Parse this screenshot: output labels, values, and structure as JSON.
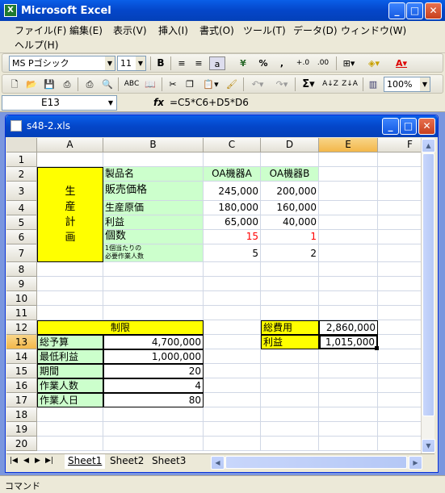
{
  "app": {
    "title": "Microsoft Excel",
    "icon_name": "excel-icon",
    "workbook_title": "s48-2.xls"
  },
  "menu": {
    "items": [
      "ファイル(F)",
      "編集(E)",
      "表示(V)",
      "挿入(I)",
      "書式(O)",
      "ツール(T)",
      "データ(D)",
      "ウィンドウ(W)"
    ],
    "help": "ヘルプ(H)"
  },
  "format_toolbar": {
    "font": "MS Pゴシック",
    "size": "11",
    "bold": "B",
    "percent": "%",
    "comma": ",",
    "inc_decimal": "+.0",
    "dec_decimal": ".00"
  },
  "standard_toolbar": {
    "zoom": "100%",
    "sigma": "Σ"
  },
  "formula_bar": {
    "name_box": "E13",
    "fx": "fx",
    "formula": "=C5*C6+D5*D6"
  },
  "columns": [
    "A",
    "B",
    "C",
    "D",
    "E",
    "F"
  ],
  "rows": [
    "1",
    "2",
    "3",
    "4",
    "5",
    "6",
    "7",
    "8",
    "9",
    "10",
    "11",
    "12",
    "13",
    "14",
    "15",
    "16",
    "17",
    "18",
    "19",
    "20"
  ],
  "sheet": {
    "A_merged": "生\n産\n計\n画",
    "B2": "製品名",
    "C2": "OA機器A",
    "D2": "OA機器B",
    "B3": "販売価格",
    "C3": "245,000",
    "D3": "200,000",
    "B4": "生産原価",
    "C4": "180,000",
    "D4": "160,000",
    "B5": "利益",
    "C5": "65,000",
    "D5": "40,000",
    "B6": "個数",
    "C6": "15",
    "D6": "1",
    "B7": "1個当たりの\n必要作業人数",
    "C7": "5",
    "D7": "2",
    "AB12": "制限",
    "A13": "総予算",
    "B13": "4,700,000",
    "A14": "最低利益",
    "B14": "1,000,000",
    "A15": "期間",
    "B15": "20",
    "A16": "作業人数",
    "B16": "4",
    "A17": "作業人日",
    "B17": "80",
    "D12": "総費用",
    "E12": "2,860,000",
    "D13": "利益",
    "E13": "1,015,000"
  },
  "tabs": [
    "Sheet1",
    "Sheet2",
    "Sheet3"
  ],
  "status": "コマンド",
  "colors": {
    "green_fill": "#ccffcc",
    "yellow_fill": "#ffff00",
    "red_text": "#ff0000",
    "selected_header": "#f3b74a"
  }
}
